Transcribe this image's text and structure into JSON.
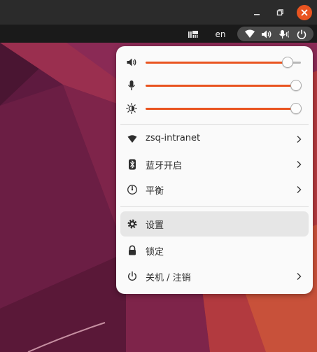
{
  "colors": {
    "accent": "#e95420",
    "menu_bg": "#fafafa",
    "panel_bg": "#1a1a1a",
    "titlebar_bg": "#2b2b2b",
    "close_button": "#e95420"
  },
  "window_controls": {
    "minimize_icon": "minimize-icon",
    "maximize_icon": "restore-icon",
    "close_icon": "close-icon"
  },
  "top_panel": {
    "indicator_icon": "input-method-icon",
    "keyboard_layout": "en",
    "system_icons": [
      "wifi-icon",
      "speaker-icon",
      "microphone-icon",
      "power-icon"
    ]
  },
  "system_menu": {
    "sliders": [
      {
        "name": "volume",
        "icon": "speaker-icon",
        "level": 0.89
      },
      {
        "name": "microphone",
        "icon": "microphone-icon",
        "level": 1.0
      },
      {
        "name": "brightness",
        "icon": "brightness-icon",
        "level": 1.0
      }
    ],
    "network": {
      "icon": "wifi-icon",
      "label": "zsq-intranet",
      "has_submenu": true
    },
    "bluetooth": {
      "icon": "bluetooth-icon",
      "label": "蓝牙开启",
      "has_submenu": true
    },
    "power_mode": {
      "icon": "power-mode-icon",
      "label": "平衡",
      "has_submenu": true
    },
    "settings": {
      "icon": "gear-icon",
      "label": "设置",
      "highlighted": true
    },
    "lock": {
      "icon": "lock-icon",
      "label": "锁定"
    },
    "shutdown": {
      "icon": "power-icon",
      "label": "关机 / 注销",
      "has_submenu": true
    }
  }
}
